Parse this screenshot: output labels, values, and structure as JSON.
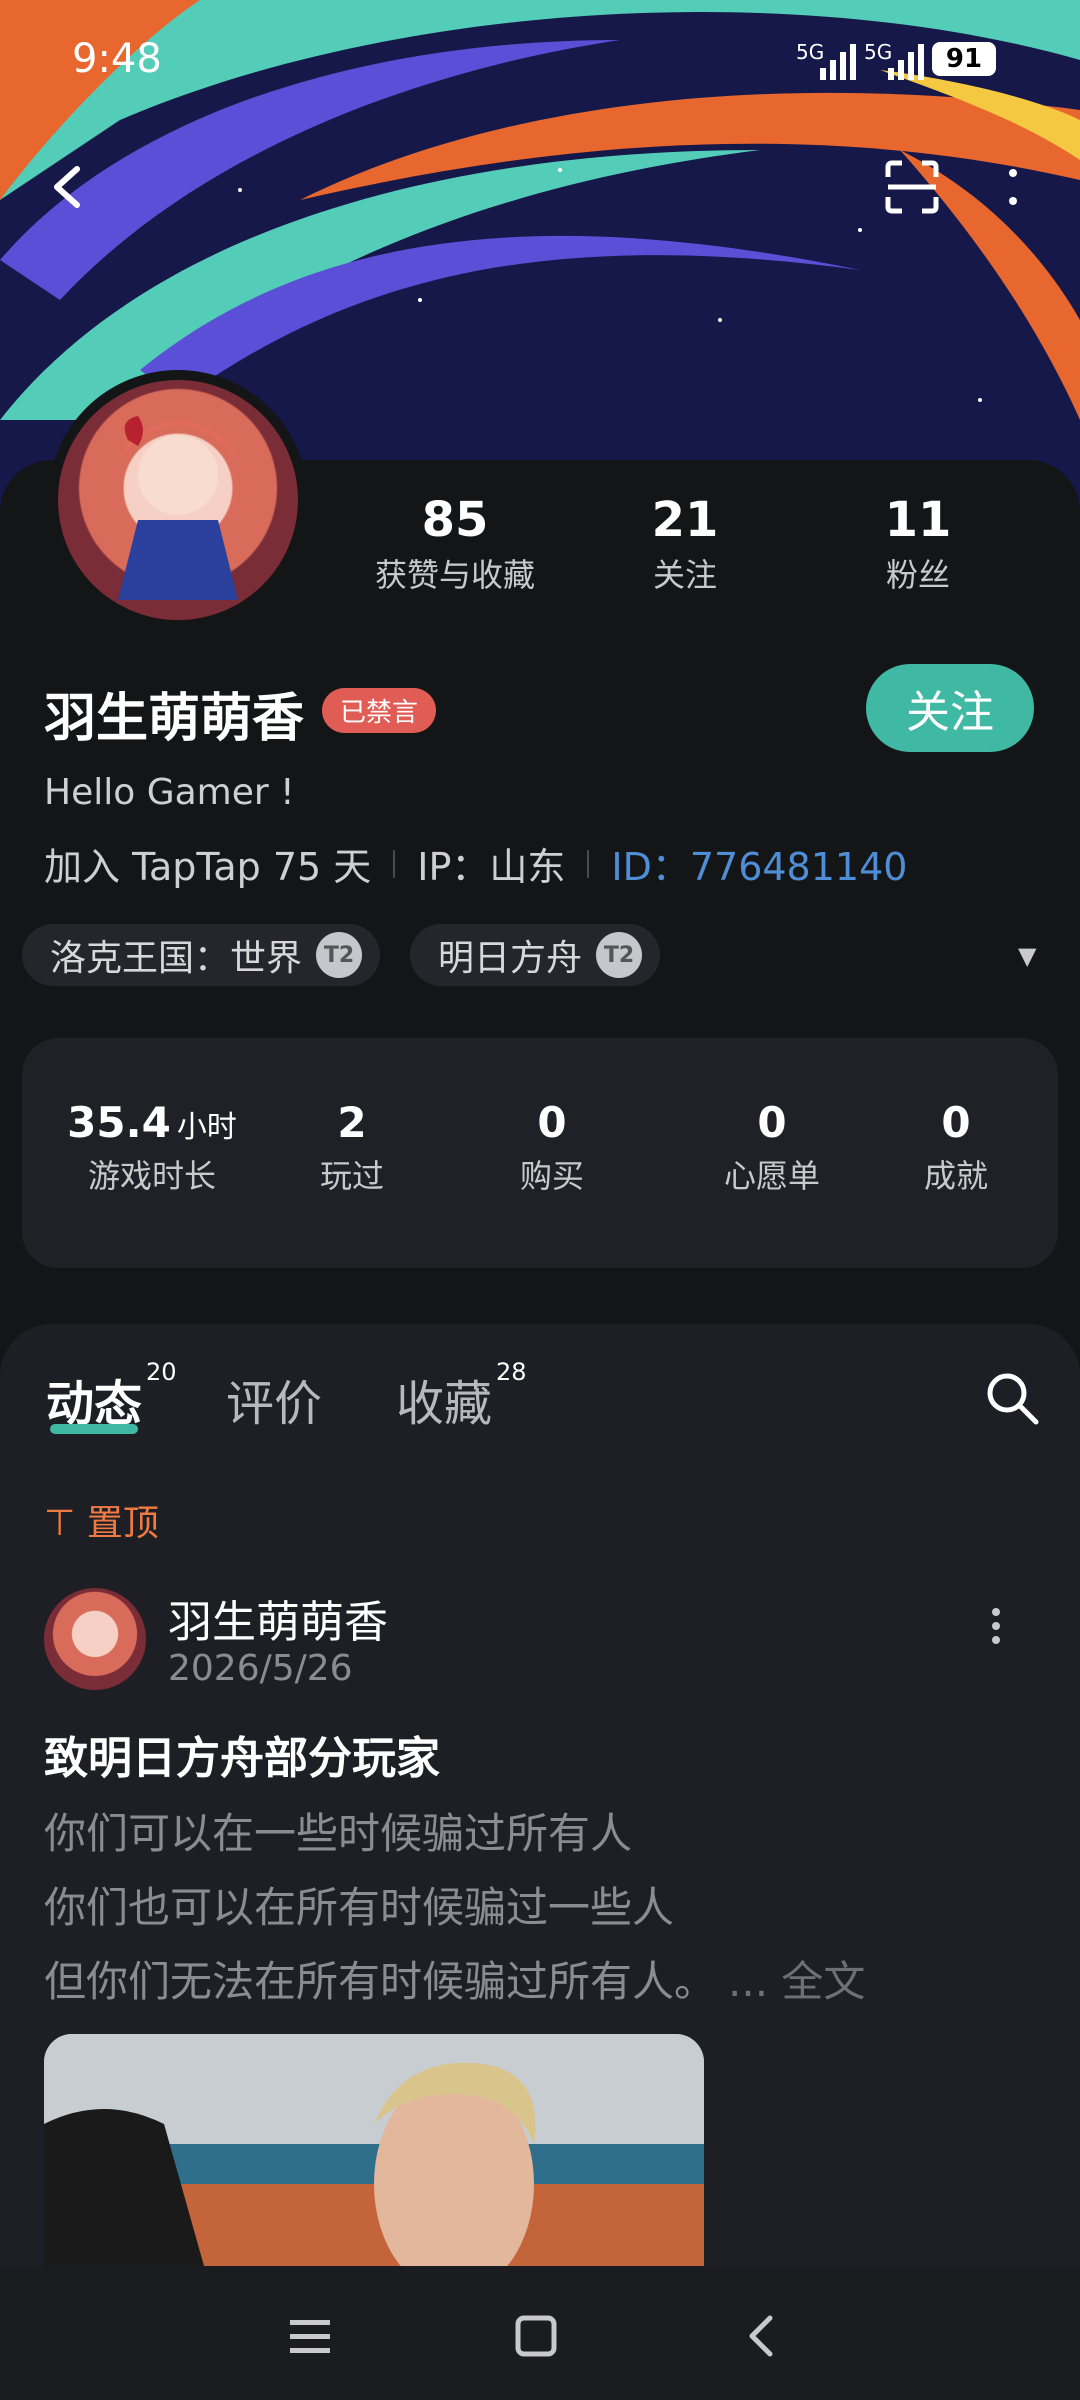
{
  "status_bar": {
    "time": "9:48",
    "signal1": "5G",
    "signal2": "5G",
    "battery": "91"
  },
  "profile": {
    "stats": [
      {
        "value": "85",
        "label": "获赞与收藏"
      },
      {
        "value": "21",
        "label": "关注"
      },
      {
        "value": "11",
        "label": "粉丝"
      }
    ],
    "name": "羽生萌萌香",
    "badge": "已禁言",
    "follow_label": "关注",
    "bio": "Hello Gamer !",
    "join": "加入 TapTap 75 天",
    "ip": "IP：山东",
    "id": "ID：776481140",
    "games": [
      {
        "name": "洛克王国：世界",
        "badge": "2"
      },
      {
        "name": "明日方舟",
        "badge": "2"
      }
    ]
  },
  "game_stats": [
    {
      "value": "35.4",
      "unit": "小时",
      "label": "游戏时长"
    },
    {
      "value": "2",
      "unit": "",
      "label": "玩过"
    },
    {
      "value": "0",
      "unit": "",
      "label": "购买"
    },
    {
      "value": "0",
      "unit": "",
      "label": "心愿单"
    },
    {
      "value": "0",
      "unit": "",
      "label": "成就"
    }
  ],
  "tabs": [
    {
      "label": "动态",
      "count": "20"
    },
    {
      "label": "评价",
      "count": ""
    },
    {
      "label": "收藏",
      "count": "28"
    }
  ],
  "post": {
    "pinned_label": "置顶",
    "author": "羽生萌萌香",
    "date": "2026/5/26",
    "title": "致明日方舟部分玩家",
    "lines": [
      "你们可以在一些时候骗过所有人",
      "你们也可以在所有时候骗过一些人",
      "但你们无法在所有时候骗过所有人。"
    ],
    "more_label": "... 全文"
  },
  "colors": {
    "accent": "#3fb9a4",
    "badge": "#e05c54",
    "pinned": "#f07a44",
    "id_link": "#4f8ed6"
  }
}
